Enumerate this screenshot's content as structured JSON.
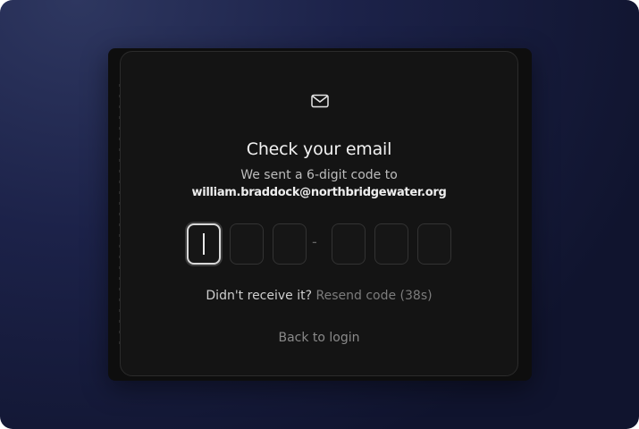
{
  "card": {
    "icon": "mail-icon",
    "title": "Check your email",
    "subtitle": "We sent a 6-digit code to",
    "email": "william.braddock@northbridgewater.org"
  },
  "otp": {
    "separator": "-",
    "digits": [
      "",
      "",
      "",
      "",
      "",
      ""
    ],
    "active_index": 0
  },
  "resend": {
    "prompt": "Didn't receive it?",
    "link_label": "Resend code (38s)"
  },
  "back_link": "Back to login",
  "colors": {
    "background": "#1c2249",
    "card": "#141414",
    "accent": "#d8d8d8"
  }
}
